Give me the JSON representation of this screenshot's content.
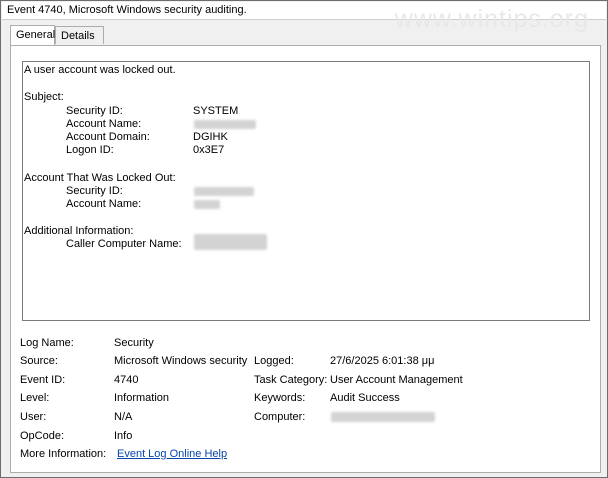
{
  "window": {
    "title": "Event 4740, Microsoft Windows security auditing."
  },
  "watermark": "www.wintips.org",
  "tabs": [
    {
      "label": "General",
      "active": true
    },
    {
      "label": "Details",
      "active": false
    }
  ],
  "message": {
    "intro": "A user account was locked out.",
    "subject_header": "Subject:",
    "subject": {
      "security_id_label": "Security ID:",
      "security_id_value": "SYSTEM",
      "account_name_label": "Account Name:",
      "account_domain_label": "Account Domain:",
      "account_domain_value": "DGIHK",
      "logon_id_label": "Logon ID:",
      "logon_id_value": "0x3E7"
    },
    "locked_header": "Account That Was Locked Out:",
    "locked": {
      "security_id_label": "Security ID:",
      "account_name_label": "Account Name:"
    },
    "additional_header": "Additional Information:",
    "additional": {
      "caller_label": "Caller Computer Name:"
    }
  },
  "properties": {
    "log_name_label": "Log Name:",
    "log_name_value": "Security",
    "source_label": "Source:",
    "source_value": "Microsoft Windows security",
    "logged_label": "Logged:",
    "logged_value": "27/6/2025 6:01:38 μμ",
    "event_id_label": "Event ID:",
    "event_id_value": "4740",
    "task_category_label": "Task Category:",
    "task_category_value": "User Account Management",
    "level_label": "Level:",
    "level_value": "Information",
    "keywords_label": "Keywords:",
    "keywords_value": "Audit Success",
    "user_label": "User:",
    "user_value": "N/A",
    "computer_label": "Computer:",
    "opcode_label": "OpCode:",
    "opcode_value": "Info",
    "more_info_label": "More Information:",
    "more_info_link": "Event Log Online Help"
  }
}
